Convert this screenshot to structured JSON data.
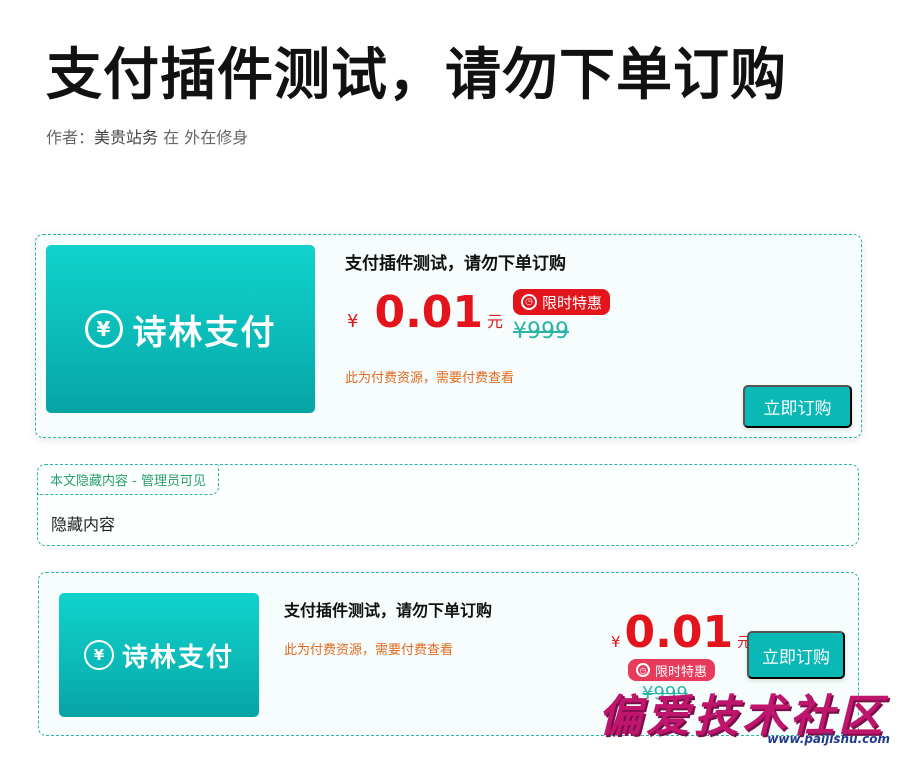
{
  "post": {
    "title": "支付插件测试，请勿下单订购",
    "byline_prefix": "作者：",
    "author": "美贵站务",
    "byline_suffix": "在 外在修身"
  },
  "product_cards": [
    {
      "thumb_icon_glyph": "¥",
      "thumb_icon_name": "yen-circle-icon",
      "thumb_text": "诗林支付",
      "title": "支付插件测试，请勿下单订购",
      "price_symbol": "¥",
      "price": "0.01",
      "price_unit": "元",
      "badge_text": "限时特惠",
      "badge_icon_name": "alarm-clock-icon",
      "original_price": "¥999",
      "note": "此为付费资源，需要付费查看",
      "buy_label": "立即订购"
    },
    {
      "thumb_icon_glyph": "¥",
      "thumb_icon_name": "yen-circle-icon",
      "thumb_text": "诗林支付",
      "title": "支付插件测试，请勿下单订购",
      "price_symbol": "¥",
      "price": "0.01",
      "price_unit": "元",
      "badge_text": "限时特惠",
      "badge_icon_name": "alarm-clock-icon",
      "original_price": "¥999",
      "note": "此为付费资源，需要付费查看",
      "buy_label": "立即订购"
    }
  ],
  "hidden_section": {
    "tab_label": "本文隐藏内容 - 管理员可见",
    "content": "隐藏内容"
  },
  "watermark": {
    "text": "偏爱技术社区",
    "url": "www.paijishu.com"
  },
  "colors": {
    "accent": "#0ab8b6",
    "price_red": "#e3141c",
    "note_orange": "#e06a1f",
    "border_teal": "#2bb3a6"
  }
}
